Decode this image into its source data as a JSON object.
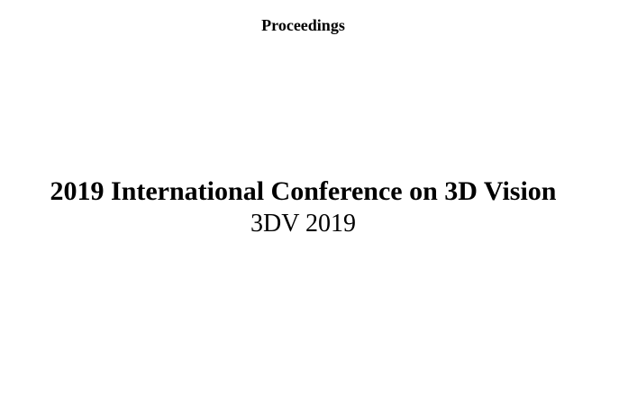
{
  "document": {
    "header": "Proceedings",
    "title": "2019 International Conference on 3D Vision",
    "subtitle": "3DV 2019"
  }
}
